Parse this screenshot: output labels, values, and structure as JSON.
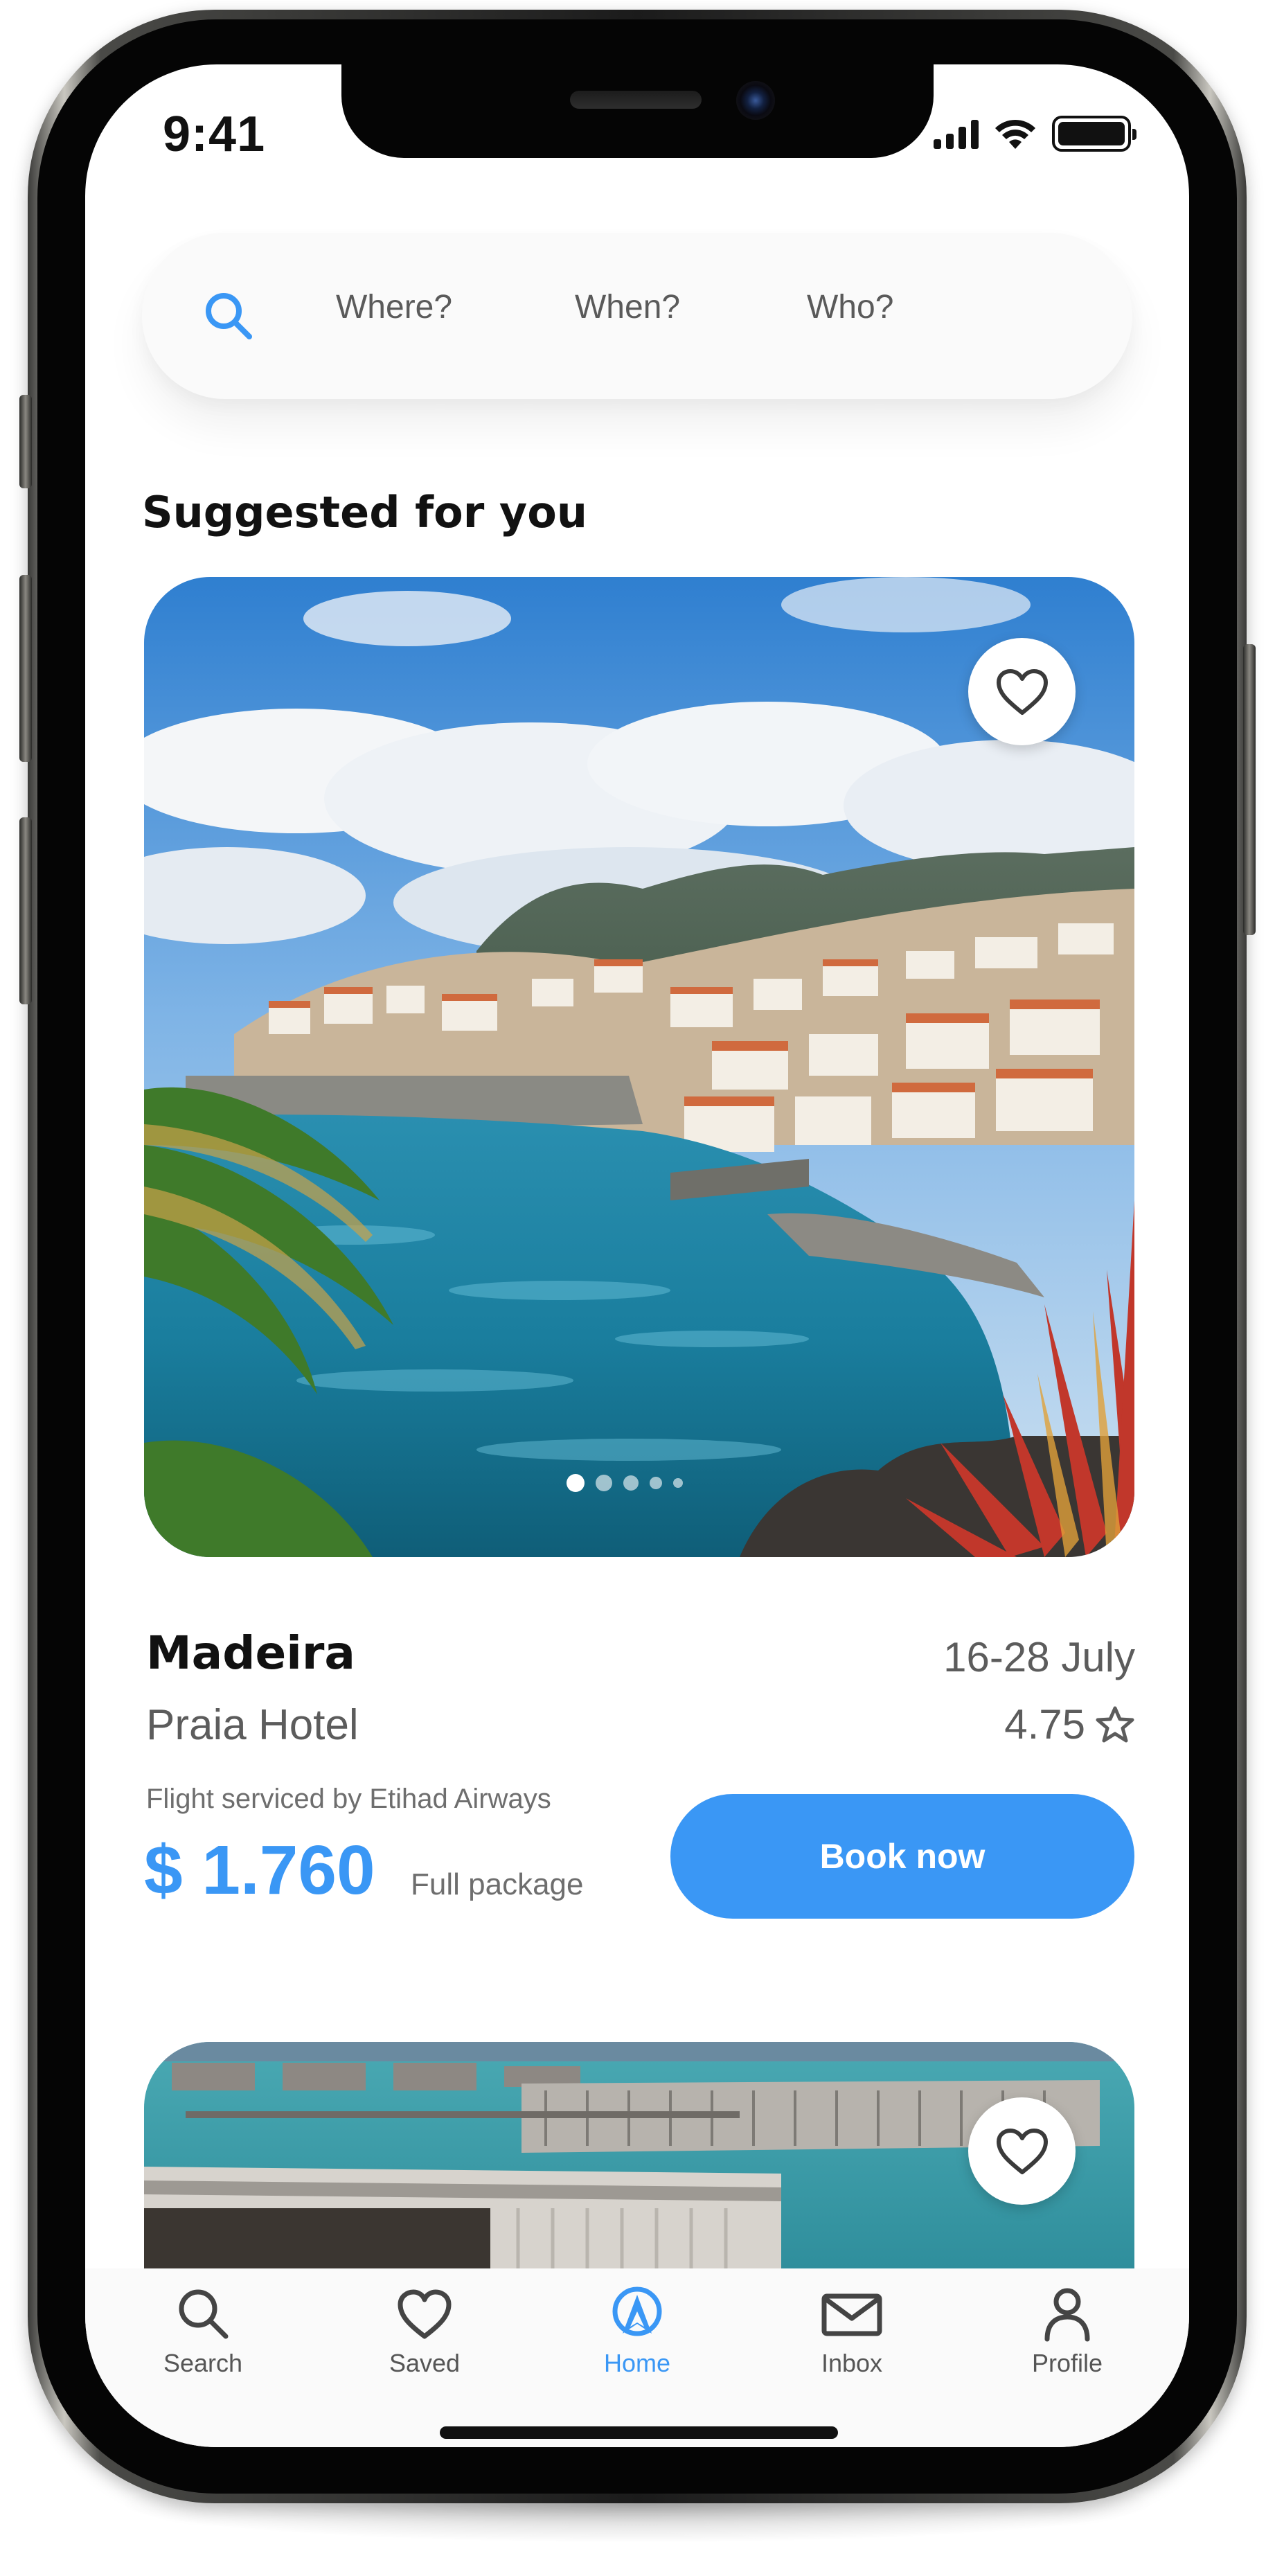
{
  "status_bar": {
    "time": "9:41"
  },
  "search": {
    "fields": [
      "Where?",
      "When?",
      "Who?"
    ]
  },
  "section": {
    "title": "Suggested for you"
  },
  "listing": {
    "destination": "Madeira",
    "dates": "16-28 July",
    "hotel": "Praia Hotel",
    "rating": "4.75",
    "flight_info": "Flight serviced by Etihad Airways",
    "price": "$ 1.760",
    "package": "Full package",
    "book_label": "Book now",
    "photo_count": 5,
    "photo_index": 1
  },
  "tabs": [
    {
      "label": "Search",
      "icon": "search-icon"
    },
    {
      "label": "Saved",
      "icon": "heart-icon"
    },
    {
      "label": "Home",
      "icon": "home-logo-icon",
      "active": true
    },
    {
      "label": "Inbox",
      "icon": "envelope-icon"
    },
    {
      "label": "Profile",
      "icon": "person-icon"
    }
  ],
  "colors": {
    "accent": "#3a97f5",
    "text": "#111111",
    "muted": "#5c5c5c"
  }
}
